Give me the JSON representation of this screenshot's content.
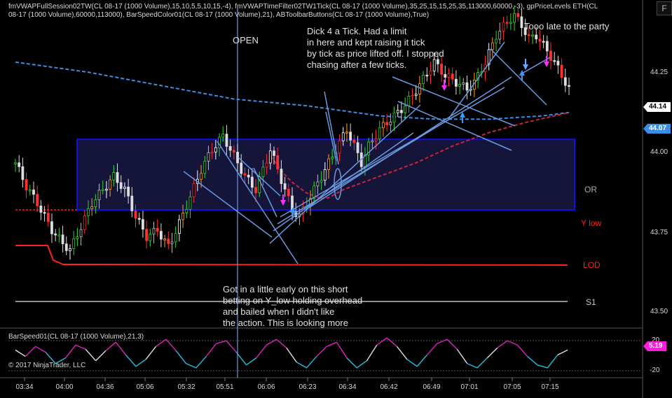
{
  "header": {
    "indicators_line1": "fmVWAPFullSession02TW(CL 08-17 (1000 Volume),15,10,5,5,10,15,-4), fmVWAPTimeFilter02TW1Tick(CL 08-17 (1000 Volume),35,25,15,15,25,35,113000,60000,-3), gpPriceLevels ETH(CL",
    "indicators_line2": "08-17 (1000 Volume),60000,113000), BarSpeedColor01(CL 08-17 (1000 Volume),21), ABToolbarButtons(CL 08-17 (1000 Volume),True)",
    "corner_button": "F"
  },
  "annotations": {
    "open": "OPEN",
    "dick": "Dick 4 a Tick. Had a limit\nin here and kept  raising it tick\nby tick as price lifted off. I stopped\nchasing after a few ticks.",
    "late": "Tooo late to the party",
    "short": "Got in a little early on this short\nbetting on Y_low holding overhead\nand bailed when I didn't like\nthe action. This is looking more"
  },
  "levels": {
    "or": "OR",
    "ylow": "Y low",
    "lod": "LOD",
    "s1": "S1"
  },
  "price_axis": {
    "ticks": [
      "44.25",
      "44.00",
      "43.75",
      "43.50"
    ],
    "last_price": "44.14",
    "vwap_price": "44.07"
  },
  "indicator_panel": {
    "title": "BarSpeed01(CL 08-17 (1000 Volume),21,3)",
    "value": "5.19",
    "ticks": [
      "20",
      "-20"
    ],
    "copyright": "© 2017 NinjaTrader, LLC"
  },
  "time_axis": [
    "03:34",
    "04:00",
    "04:36",
    "05:06",
    "05:32",
    "05:51",
    "06:06",
    "06:23",
    "06:34",
    "06:42",
    "06:49",
    "07:01",
    "07:05",
    "07:15"
  ],
  "colors": {
    "background": "#000000",
    "box_border": "#1010e0",
    "box_fill": "#15153a",
    "ylow": "#ff2020",
    "lod": "#ff2020",
    "s1": "#c0c0c0",
    "vwap": "#3a8ee6",
    "vwap_tf": "#c8243c",
    "trendline": "#6a9ae0",
    "last_price_tag": "#ffffff",
    "vwap_tag": "#3a8ee6",
    "indicator_tag": "#ff1ae0"
  },
  "chart_data": {
    "type": "candlestick",
    "instrument": "CL 08-17 (1000 Volume)",
    "price_range": [
      43.43,
      44.38
    ],
    "close_path": [
      [
        0,
        43.92
      ],
      [
        3,
        43.85
      ],
      [
        6,
        43.8
      ],
      [
        8,
        43.76
      ],
      [
        10,
        43.72
      ],
      [
        13,
        43.68
      ],
      [
        15,
        43.66
      ],
      [
        18,
        43.73
      ],
      [
        21,
        43.8
      ],
      [
        24,
        43.84
      ],
      [
        27,
        43.88
      ],
      [
        30,
        43.84
      ],
      [
        33,
        43.76
      ],
      [
        36,
        43.7
      ],
      [
        39,
        43.72
      ],
      [
        42,
        43.67
      ],
      [
        45,
        43.74
      ],
      [
        48,
        43.82
      ],
      [
        51,
        43.9
      ],
      [
        54,
        43.96
      ],
      [
        57,
        44.0
      ],
      [
        60,
        43.94
      ],
      [
        63,
        43.88
      ],
      [
        66,
        43.84
      ],
      [
        68,
        43.9
      ],
      [
        70,
        43.96
      ],
      [
        72,
        43.9
      ],
      [
        74,
        43.84
      ],
      [
        76,
        43.78
      ],
      [
        78,
        43.76
      ],
      [
        80,
        43.8
      ],
      [
        82,
        43.84
      ],
      [
        85,
        43.9
      ],
      [
        88,
        43.96
      ],
      [
        91,
        44.02
      ],
      [
        93,
        43.97
      ],
      [
        95,
        43.92
      ],
      [
        97,
        43.97
      ],
      [
        100,
        44.02
      ],
      [
        103,
        44.05
      ],
      [
        106,
        44.08
      ],
      [
        109,
        44.12
      ],
      [
        112,
        44.17
      ],
      [
        115,
        44.22
      ],
      [
        118,
        44.18
      ],
      [
        121,
        44.16
      ],
      [
        124,
        44.14
      ],
      [
        126,
        44.16
      ],
      [
        129,
        44.22
      ],
      [
        132,
        44.3
      ],
      [
        135,
        44.34
      ],
      [
        137,
        44.36
      ],
      [
        139,
        44.33
      ],
      [
        141,
        44.29
      ],
      [
        143,
        44.3
      ],
      [
        145,
        44.27
      ],
      [
        148,
        44.22
      ],
      [
        150,
        44.18
      ],
      [
        152,
        44.14
      ]
    ],
    "bar_count": 153,
    "vwap_full": [
      [
        0,
        44.22
      ],
      [
        20,
        44.19
      ],
      [
        40,
        44.15
      ],
      [
        60,
        44.11
      ],
      [
        80,
        44.09
      ],
      [
        100,
        44.06
      ],
      [
        115,
        44.05
      ],
      [
        130,
        44.05
      ],
      [
        145,
        44.06
      ],
      [
        152,
        44.07
      ]
    ],
    "vwap_filtered": [
      [
        70,
        43.94
      ],
      [
        75,
        43.87
      ],
      [
        80,
        43.83
      ],
      [
        85,
        43.81
      ],
      [
        90,
        43.84
      ],
      [
        100,
        43.88
      ],
      [
        110,
        43.92
      ],
      [
        120,
        43.97
      ],
      [
        130,
        44.01
      ],
      [
        140,
        44.04
      ],
      [
        152,
        44.07
      ]
    ],
    "opening_range": [
      43.78,
      43.99
    ],
    "y_low": 43.78,
    "lod": 43.65,
    "s1": 43.55,
    "indicator_range": [
      -25,
      25
    ],
    "indicator_values": [
      5,
      -4,
      10,
      2,
      -14,
      -6,
      12,
      6,
      -10,
      4,
      16,
      -2,
      -18,
      -8,
      10,
      20,
      4,
      -14,
      -20,
      -4,
      14,
      18,
      2,
      -16,
      -6,
      12,
      20,
      8,
      -12,
      -20,
      -4,
      10,
      16,
      -6,
      -20,
      -10,
      12,
      22,
      10,
      -8,
      -18,
      -2,
      14,
      20,
      6,
      -14,
      -20,
      -6,
      8,
      18,
      12,
      -4,
      -16,
      -20,
      -2,
      5
    ]
  }
}
